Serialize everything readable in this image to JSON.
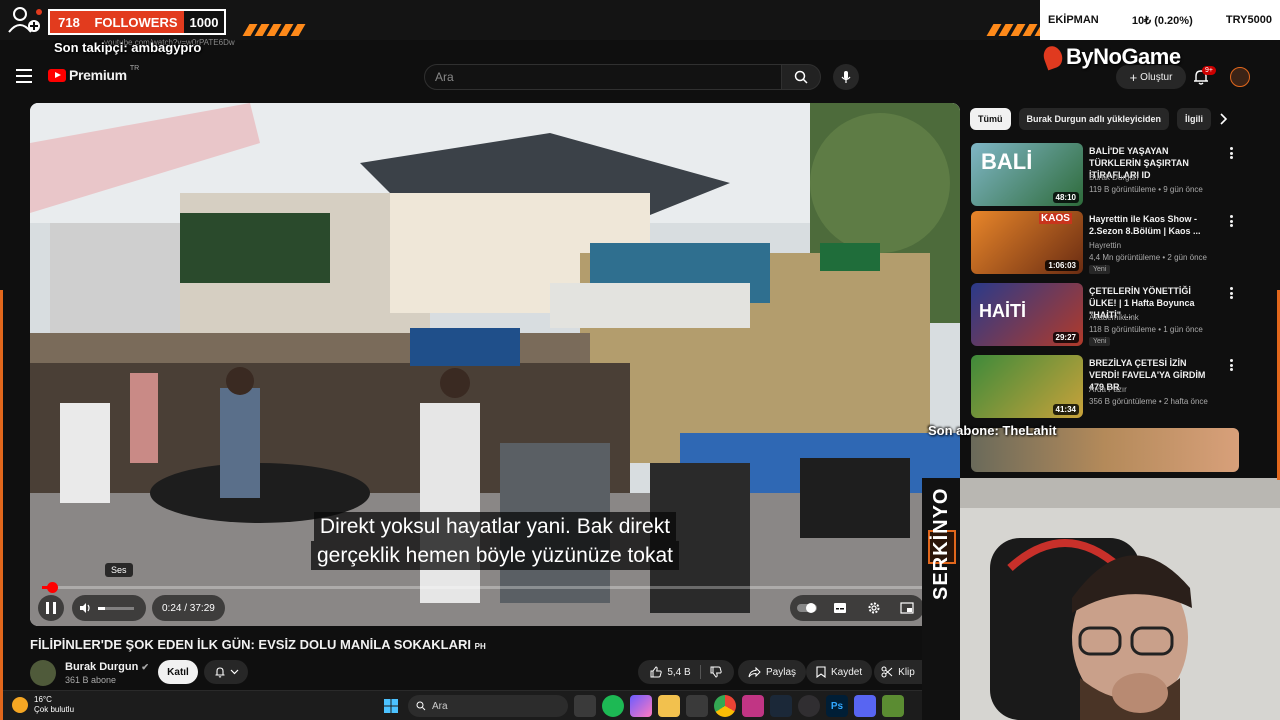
{
  "overlay": {
    "followers_current": "718",
    "followers_label": "FOLLOWERS",
    "followers_goal": "1000",
    "last_follower": "Son takipçi: ambagypro",
    "url_fragment": "youtube.com/watch?v=w0rPATE6Dw",
    "equipment_label": "EKİPMAN",
    "equipment_value": "10₺ (0.20%)",
    "equipment_goal": "TRY5000",
    "sponsor": "ByNoGame",
    "last_subscriber": "Son abone: TheLahit",
    "streamer_name": "SERKİNYO"
  },
  "header": {
    "logo_text": "Premium",
    "logo_region": "TR",
    "search_placeholder": "Ara",
    "create_label": "Oluştur",
    "notif_badge": "9+"
  },
  "player": {
    "caption_line1": "Direkt yoksul hayatlar yani. Bak direkt",
    "caption_line2": "gerçeklik hemen böyle yüzünüze tokat",
    "tooltip": "Ses",
    "time": "0:24 / 37:29",
    "progress_fraction": 0.011
  },
  "video": {
    "title": "FİLİPİNLER'DE ŞOK EDEN İLK GÜN: EVSİZ DOLU MANİLA SOKAKLARI",
    "title_flag": "PH",
    "channel_name": "Burak Durgun",
    "channel_subs": "361 B abone",
    "join_label": "Katıl",
    "likes": "5,4 B",
    "share_label": "Paylaş",
    "save_label": "Kaydet",
    "clip_label": "Klip"
  },
  "sidebar": {
    "chips": [
      "Tümü",
      "Burak Durgun adlı yükleyiciden",
      "İlgili"
    ],
    "recommendations": [
      {
        "title": "BALİ'DE YAŞAYAN TÜRKLERİN ŞAŞIRTAN İTİRAFLARI ID",
        "channel": "Burak Durgun",
        "meta": "119 B görüntüleme • 9 gün önce",
        "duration": "48:10",
        "new": ""
      },
      {
        "title": "Hayrettin ile Kaos Show - 2.Sezon 8.Bölüm | Kaos ...",
        "channel": "Hayrettin",
        "meta": "4,4 Mn görüntüleme • 2 gün önce",
        "duration": "1:06:03",
        "new": "Yeni"
      },
      {
        "title": "ÇETELERİN YÖNETTİĞİ ÜLKE! | 1 Hafta Boyunca \"HAİTİ\" ...",
        "channel": "AkademikLink",
        "meta": "118 B görüntüleme • 1 gün önce",
        "duration": "29:27",
        "new": "Yeni"
      },
      {
        "title": "BREZİLYA ÇETESİ İZİN VERDİ! FAVELA'YA GİRDİM 479 BR",
        "channel": "Arda Pazır",
        "meta": "356 B görüntüleme • 2 hafta önce",
        "duration": "41:34",
        "new": ""
      }
    ]
  },
  "taskbar": {
    "temp": "16°C",
    "weather": "Çok bulutlu",
    "search": "Ara"
  }
}
